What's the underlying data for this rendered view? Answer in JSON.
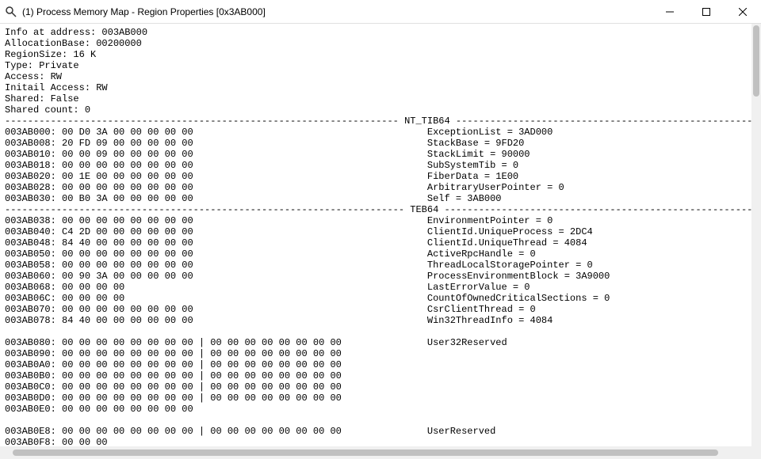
{
  "window": {
    "title": "(1) Process Memory Map - Region Properties [0x3AB000]"
  },
  "info": {
    "lines": [
      "Info at address: 003AB000",
      "AllocationBase: 00200000",
      "RegionSize: 16 K",
      "Type: Private",
      "Access: RW",
      "Initail Access: RW",
      "Shared: False",
      "Shared count: 0"
    ]
  },
  "dividerChar": "-",
  "dividerWidth": 148,
  "sections": [
    {
      "name": "NT_TIB64",
      "dividerLabel": " NT_TIB64 ",
      "rows": [
        {
          "addr": "003AB000",
          "hex": "00 D0 3A 00 00 00 00 00",
          "tail": "",
          "note": "ExceptionList = 3AD000"
        },
        {
          "addr": "003AB008",
          "hex": "20 FD 09 00 00 00 00 00",
          "tail": "",
          "note": "StackBase = 9FD20"
        },
        {
          "addr": "003AB010",
          "hex": "00 00 09 00 00 00 00 00",
          "tail": "",
          "note": "StackLimit = 90000"
        },
        {
          "addr": "003AB018",
          "hex": "00 00 00 00 00 00 00 00",
          "tail": "",
          "note": "SubSystemTib = 0"
        },
        {
          "addr": "003AB020",
          "hex": "00 1E 00 00 00 00 00 00",
          "tail": "",
          "note": "FiberData = 1E00"
        },
        {
          "addr": "003AB028",
          "hex": "00 00 00 00 00 00 00 00",
          "tail": "",
          "note": "ArbitraryUserPointer = 0"
        },
        {
          "addr": "003AB030",
          "hex": "00 B0 3A 00 00 00 00 00",
          "tail": "",
          "note": "Self = 3AB000"
        }
      ]
    },
    {
      "name": "TEB64",
      "dividerLabel": " TEB64 ",
      "rows": [
        {
          "addr": "003AB038",
          "hex": "00 00 00 00 00 00 00 00",
          "tail": "",
          "note": "EnvironmentPointer = 0"
        },
        {
          "addr": "003AB040",
          "hex": "C4 2D 00 00 00 00 00 00",
          "tail": "",
          "note": "ClientId.UniqueProcess = 2DC4"
        },
        {
          "addr": "003AB048",
          "hex": "84 40 00 00 00 00 00 00",
          "tail": "",
          "note": "ClientId.UniqueThread = 4084"
        },
        {
          "addr": "003AB050",
          "hex": "00 00 00 00 00 00 00 00",
          "tail": "",
          "note": "ActiveRpcHandle = 0"
        },
        {
          "addr": "003AB058",
          "hex": "00 00 00 00 00 00 00 00",
          "tail": "",
          "note": "ThreadLocalStoragePointer = 0"
        },
        {
          "addr": "003AB060",
          "hex": "00 90 3A 00 00 00 00 00",
          "tail": "",
          "note": "ProcessEnvironmentBlock = 3A9000"
        },
        {
          "addr": "003AB068",
          "hex": "00 00 00 00",
          "tail": "",
          "note": "LastErrorValue = 0"
        },
        {
          "addr": "003AB06C",
          "hex": "00 00 00 00",
          "tail": "",
          "note": "CountOfOwnedCriticalSections = 0"
        },
        {
          "addr": "003AB070",
          "hex": "00 00 00 00 00 00 00 00",
          "tail": "",
          "note": "CsrClientThread = 0"
        },
        {
          "addr": "003AB078",
          "hex": "84 40 00 00 00 00 00 00",
          "tail": "",
          "note": "Win32ThreadInfo = 4084"
        }
      ]
    },
    {
      "name": "Blank1",
      "dividerLabel": "",
      "blank": true,
      "rows": [
        {
          "addr": "003AB080",
          "hex": "00 00 00 00 00 00 00 00",
          "tail": " | 00 00 00 00 00 00 00 00",
          "note": "User32Reserved"
        },
        {
          "addr": "003AB090",
          "hex": "00 00 00 00 00 00 00 00",
          "tail": " | 00 00 00 00 00 00 00 00",
          "note": ""
        },
        {
          "addr": "003AB0A0",
          "hex": "00 00 00 00 00 00 00 00",
          "tail": " | 00 00 00 00 00 00 00 00",
          "note": ""
        },
        {
          "addr": "003AB0B0",
          "hex": "00 00 00 00 00 00 00 00",
          "tail": " | 00 00 00 00 00 00 00 00",
          "note": ""
        },
        {
          "addr": "003AB0C0",
          "hex": "00 00 00 00 00 00 00 00",
          "tail": " | 00 00 00 00 00 00 00 00",
          "note": ""
        },
        {
          "addr": "003AB0D0",
          "hex": "00 00 00 00 00 00 00 00",
          "tail": " | 00 00 00 00 00 00 00 00",
          "note": ""
        },
        {
          "addr": "003AB0E0",
          "hex": "00 00 00 00 00 00 00 00",
          "tail": "",
          "note": ""
        }
      ]
    },
    {
      "name": "Blank2",
      "dividerLabel": "",
      "blank": true,
      "rows": [
        {
          "addr": "003AB0E8",
          "hex": "00 00 00 00 00 00 00 00",
          "tail": " | 00 00 00 00 00 00 00 00",
          "note": "UserReserved"
        },
        {
          "addr": "003AB0F8",
          "hex": "00 00 00",
          "tail": "",
          "note": ""
        }
      ]
    }
  ],
  "layout": {
    "hexColWidth": 52,
    "noteCol": 74
  }
}
